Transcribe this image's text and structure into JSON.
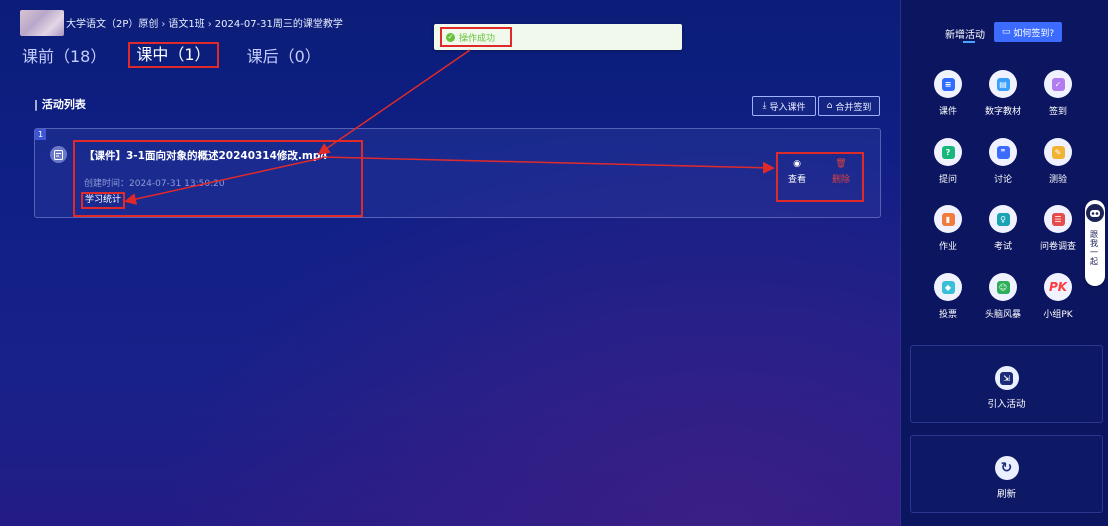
{
  "breadcrumb": {
    "course": "大学语文（2P）原创",
    "class": "语文1班",
    "lesson": "2024-07-31周三的课堂教学"
  },
  "tabs": [
    {
      "label": "课前（18）",
      "active": false
    },
    {
      "label": "课中（1）",
      "active": true
    },
    {
      "label": "课后（0）",
      "active": false
    }
  ],
  "toast": {
    "text": "操作成功",
    "type": "success"
  },
  "activity_list": {
    "title": "活动列表",
    "import_label": "导入课件",
    "merge_label": "合并签到",
    "items": [
      {
        "index": "1",
        "title": "【课件】3-1面向对象的概述20240314修改.mp4",
        "created": "创建时间：2024-07-31 13:50:20",
        "stats_label": "学习统计",
        "view_label": "查看",
        "delete_label": "删除"
      }
    ]
  },
  "sidebar": {
    "heading": "新增活动",
    "howto_label": "如何签到?",
    "activities": [
      {
        "label": "课件",
        "icon": "courseware-icon",
        "color": "#2f6bff"
      },
      {
        "label": "数字教材",
        "icon": "digital-textbook-icon",
        "color": "#3aa0ff"
      },
      {
        "label": "签到",
        "icon": "sign-in-icon",
        "color": "#b37bf0"
      },
      {
        "label": "提问",
        "icon": "question-icon",
        "color": "#18b77a"
      },
      {
        "label": "讨论",
        "icon": "discussion-icon",
        "color": "#3b6cff"
      },
      {
        "label": "测验",
        "icon": "quiz-icon",
        "color": "#f2b233"
      },
      {
        "label": "作业",
        "icon": "homework-icon",
        "color": "#f27a3a"
      },
      {
        "label": "考试",
        "icon": "exam-icon",
        "color": "#1aa3b5"
      },
      {
        "label": "问卷调查",
        "icon": "survey-icon",
        "color": "#e54d4d"
      },
      {
        "label": "投票",
        "icon": "vote-icon",
        "color": "#38c0d8"
      },
      {
        "label": "头脑风暴",
        "icon": "brainstorm-icon",
        "color": "#2fae5a"
      },
      {
        "label": "小组PK",
        "icon": "group-pk-icon",
        "color": "#ff3b3b"
      }
    ],
    "import_activity_label": "引入活动",
    "refresh_label": "刷新"
  },
  "assistant": {
    "label": "跟我一起"
  },
  "colors": {
    "highlight": "#e02a2a",
    "accent": "#3b6cff",
    "success": "#67c23a"
  }
}
